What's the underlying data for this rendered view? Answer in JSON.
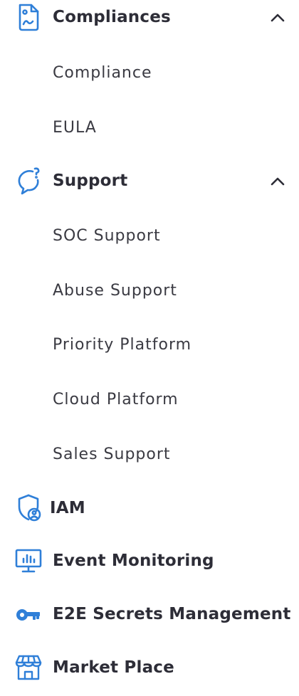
{
  "colors": {
    "icon_blue": "#2f7fd8",
    "text": "#2d2d37"
  },
  "sections": {
    "compliances": {
      "label": "Compliances",
      "icon": "document-image-icon",
      "chevron": "chevron-up-icon"
    },
    "support": {
      "label": "Support",
      "icon": "chat-question-icon",
      "chevron": "chevron-up-icon"
    },
    "iam": {
      "label": "IAM",
      "icon": "shield-user-icon"
    },
    "event_monitoring": {
      "label": "Event Monitoring",
      "icon": "monitor-chart-icon"
    },
    "e2e_secrets": {
      "label": "E2E Secrets Management",
      "icon": "key-icon"
    },
    "market_place": {
      "label": "Market Place",
      "icon": "storefront-icon"
    }
  },
  "compliances_items": [
    "Compliance",
    "EULA"
  ],
  "support_items": [
    "SOC Support",
    "Abuse Support",
    "Priority Platform",
    "Cloud Platform",
    "Sales Support"
  ]
}
